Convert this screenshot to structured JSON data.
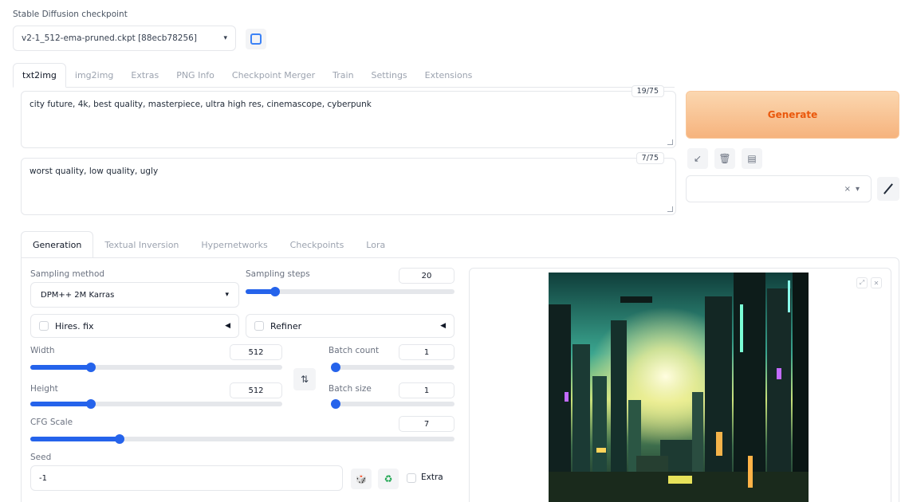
{
  "checkpoint": {
    "label": "Stable Diffusion checkpoint",
    "value": "v2-1_512-ema-pruned.ckpt [88ecb78256]"
  },
  "main_tabs": [
    "txt2img",
    "img2img",
    "Extras",
    "PNG Info",
    "Checkpoint Merger",
    "Train",
    "Settings",
    "Extensions"
  ],
  "prompt": {
    "text": "city future, 4k, best quality, masterpiece, ultra high res, cinemascope, cyberpunk",
    "counter": "19/75"
  },
  "negative_prompt": {
    "text": "worst quality, low quality, ugly",
    "counter": "7/75"
  },
  "generate_label": "Generate",
  "tools": [
    "↙",
    "🗑",
    "▤"
  ],
  "style_select": {
    "clear": "×",
    "arrow": "▾"
  },
  "sub_tabs": [
    "Generation",
    "Textual Inversion",
    "Hypernetworks",
    "Checkpoints",
    "Lora"
  ],
  "generation": {
    "sampling_method_label": "Sampling method",
    "sampling_method": "DPM++ 2M Karras",
    "sampling_steps_label": "Sampling steps",
    "sampling_steps": "20",
    "hires_label": "Hires. fix",
    "refiner_label": "Refiner",
    "width_label": "Width",
    "width": "512",
    "height_label": "Height",
    "height": "512",
    "batch_count_label": "Batch count",
    "batch_count": "1",
    "batch_size_label": "Batch size",
    "batch_size": "1",
    "cfg_label": "CFG Scale",
    "cfg": "7",
    "seed_label": "Seed",
    "seed": "-1",
    "extra_label": "Extra",
    "swap_icon": "⇅",
    "dice_icon": "🎲",
    "recycle_icon": "♻"
  },
  "sliders": {
    "sampling_steps_fraction": 0.14,
    "width_fraction": 0.24,
    "height_fraction": 0.24,
    "batch_count_fraction": 0.02,
    "batch_size_fraction": 0.02,
    "cfg_fraction": 0.21
  },
  "colors": {
    "accent": "#2563eb",
    "generate": "#ea580c"
  }
}
